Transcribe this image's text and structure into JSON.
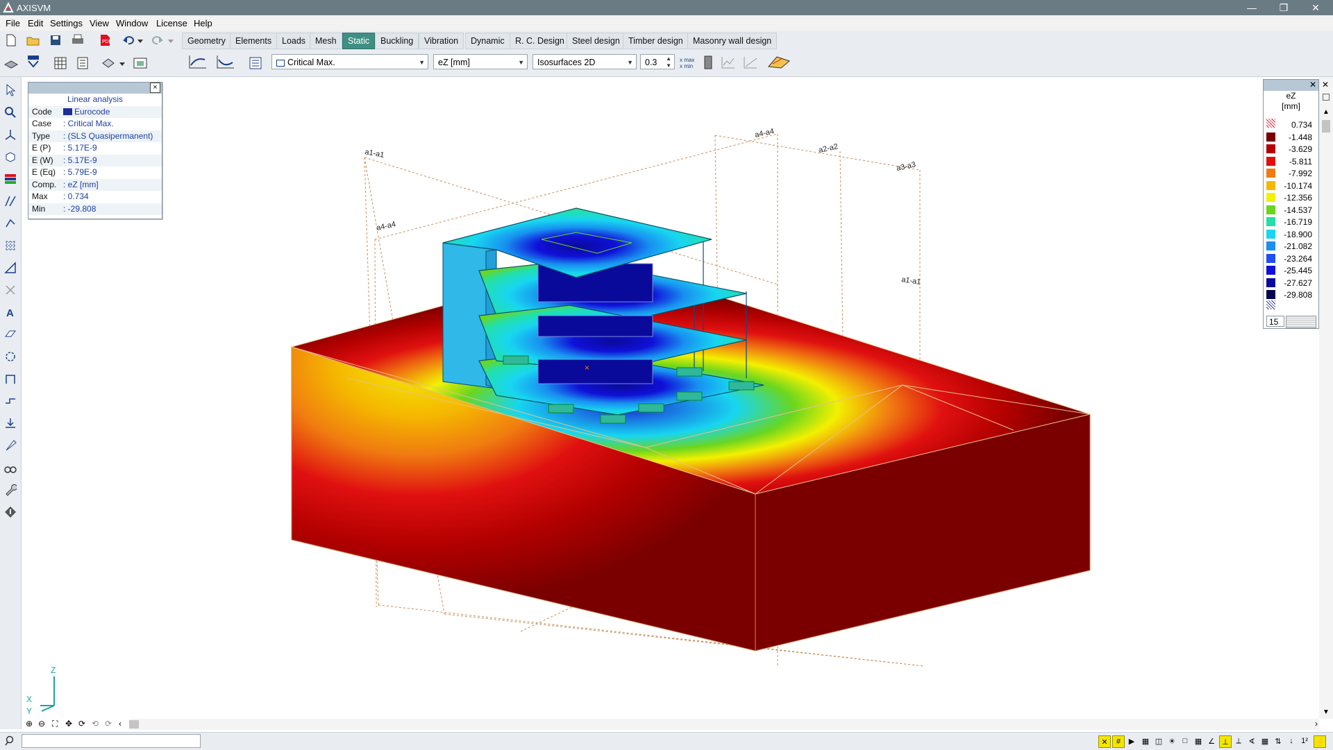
{
  "window": {
    "title": "AXISVM"
  },
  "menu": [
    "File",
    "Edit",
    "Settings",
    "View",
    "Window",
    "License",
    "Help"
  ],
  "tabs": [
    {
      "label": "Geometry",
      "active": false
    },
    {
      "label": "Elements",
      "active": false
    },
    {
      "label": "Loads",
      "active": false
    },
    {
      "label": "Mesh",
      "active": false
    },
    {
      "label": "Static",
      "active": true
    },
    {
      "label": "Buckling",
      "active": false
    },
    {
      "label": "Vibration",
      "active": false
    },
    {
      "label": "Dynamic",
      "active": false
    },
    {
      "label": "R. C. Design",
      "active": false
    },
    {
      "label": "Steel design",
      "active": false
    },
    {
      "label": "Timber design",
      "active": false
    },
    {
      "label": "Masonry wall design",
      "active": false
    }
  ],
  "toolbar": {
    "case_select": "Critical Max.",
    "component_select": "eZ [mm]",
    "display_select": "Isosurfaces 2D",
    "scale_value": "0.3"
  },
  "info": {
    "title": "Linear analysis",
    "rows": [
      {
        "key": "Code",
        "value": "Eurocode"
      },
      {
        "key": "Case",
        "value": ": Critical Max."
      },
      {
        "key": "Type",
        "value": ": (SLS Quasipermanent)"
      },
      {
        "key": "E (P)",
        "value": ": 5.17E-9"
      },
      {
        "key": "E (W)",
        "value": ": 5.17E-9"
      },
      {
        "key": "E (Eq)",
        "value": ": 5.79E-9"
      },
      {
        "key": "Comp.",
        "value": ": eZ [mm]"
      },
      {
        "key": "Max",
        "value": ": 0.734"
      },
      {
        "key": "Min",
        "value": ": -29.808"
      }
    ]
  },
  "legend": {
    "title": "eZ",
    "unit": "[mm]",
    "levels": [
      {
        "value": "0.734",
        "color": "#ffffff"
      },
      {
        "value": "-1.448",
        "color": "#7a0000"
      },
      {
        "value": "-3.629",
        "color": "#b30000"
      },
      {
        "value": "-5.811",
        "color": "#e01010"
      },
      {
        "value": "-7.992",
        "color": "#f07c10"
      },
      {
        "value": "-10.174",
        "color": "#f5b800"
      },
      {
        "value": "-12.356",
        "color": "#f3f000"
      },
      {
        "value": "-14.537",
        "color": "#6ad620"
      },
      {
        "value": "-16.719",
        "color": "#22e0a8"
      },
      {
        "value": "-18.900",
        "color": "#18d6f0"
      },
      {
        "value": "-21.082",
        "color": "#1890f0"
      },
      {
        "value": "-23.264",
        "color": "#1f4ef5"
      },
      {
        "value": "-25.445",
        "color": "#1010d8"
      },
      {
        "value": "-27.627",
        "color": "#0a0a9a"
      },
      {
        "value": "-29.808",
        "color": "#050550"
      }
    ],
    "count": "15"
  },
  "gridlines": [
    "a1-a1",
    "a4-a4",
    "a2-a2",
    "a3-a3",
    "a4-a4",
    "a1-a1"
  ],
  "axes": {
    "z": "Z",
    "x": "X",
    "y": "Y"
  }
}
